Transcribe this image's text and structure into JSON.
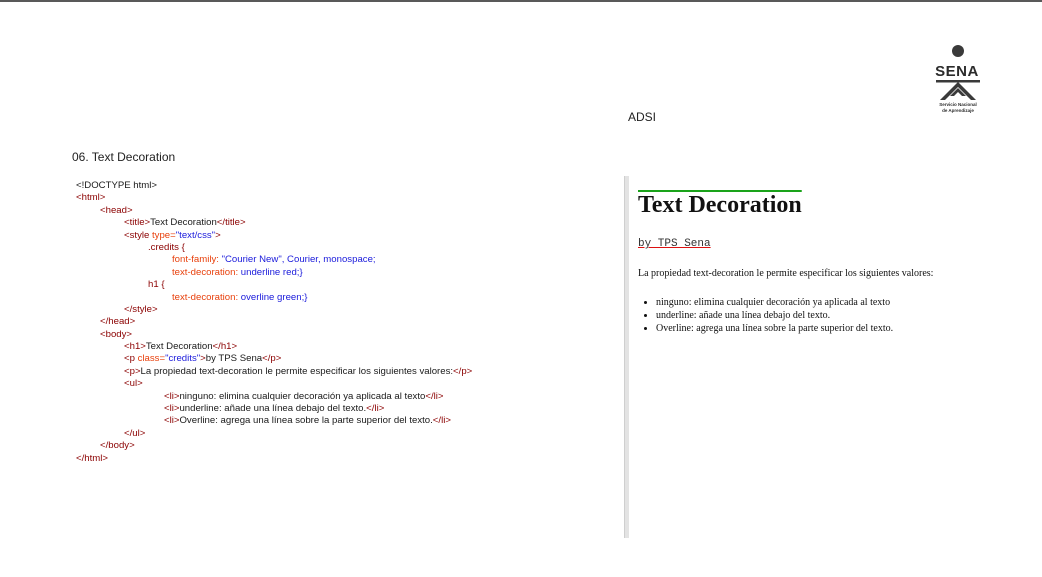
{
  "header": {
    "adsi": "ADSI"
  },
  "logo": {
    "name": "SENA",
    "subtitle_line1": "Servicio Nacional",
    "subtitle_line2": "de Aprendizaje"
  },
  "section_title": "06. Text Decoration",
  "code": {
    "doctype": "<!DOCTYPE html>",
    "html_open": "<html>",
    "head_open": "<head>",
    "title_open": "<title>",
    "title_text": "Text Decoration",
    "title_close": "</title>",
    "style_open_pre": "<style ",
    "style_attr": "type=",
    "style_attr_val": "\"text/css\"",
    "style_open_end": ">",
    "credits_sel": ".credits {",
    "ff_prop": "font-family: ",
    "ff_val": "\"Courier New\", Courier, monospace;",
    "td1_prop": "text-decoration: ",
    "td1_val": "underline red;}",
    "h1_sel": "h1 {",
    "td2_prop": "text-decoration: ",
    "td2_val": "overline green;}",
    "style_close": "</style>",
    "head_close": "</head>",
    "body_open": "<body>",
    "h1_open": "<h1>",
    "h1_text": "Text Decoration",
    "h1_close": "</h1>",
    "p1_open_pre": "<p ",
    "p1_attr": "class=",
    "p1_attr_val": "\"credits\"",
    "p1_open_end": ">",
    "p1_text": "by TPS Sena",
    "p1_close": "</p>",
    "p2_open": "<p>",
    "p2_text": "La propiedad text-decoration le permite especificar los siguientes valores:",
    "p2_close": "</p>",
    "ul_open": "<ul>",
    "li_open": "<li>",
    "li_close": "</li>",
    "li1_text": "ninguno: elimina cualquier decoración ya aplicada al texto",
    "li2_text": "underline: añade una línea debajo del texto.",
    "li3_text": "Overline: agrega una línea sobre la parte superior del texto.",
    "ul_close": "</ul>",
    "body_close": "</body>",
    "html_close": "</html>"
  },
  "preview": {
    "h1": "Text Decoration",
    "credits": "by TPS Sena",
    "paragraph": "La propiedad text-decoration le permite especificar los siguientes valores:",
    "items": [
      "ninguno: elimina cualquier decoración ya aplicada al texto",
      "underline: añade una línea debajo del texto.",
      "Overline: agrega una línea sobre la parte superior del texto."
    ]
  },
  "colors": {
    "tag": "#8b0000",
    "attribute": "#e8400c",
    "value": "#1a1adb",
    "overline": "#1aa31a",
    "underline": "#dd1111"
  }
}
